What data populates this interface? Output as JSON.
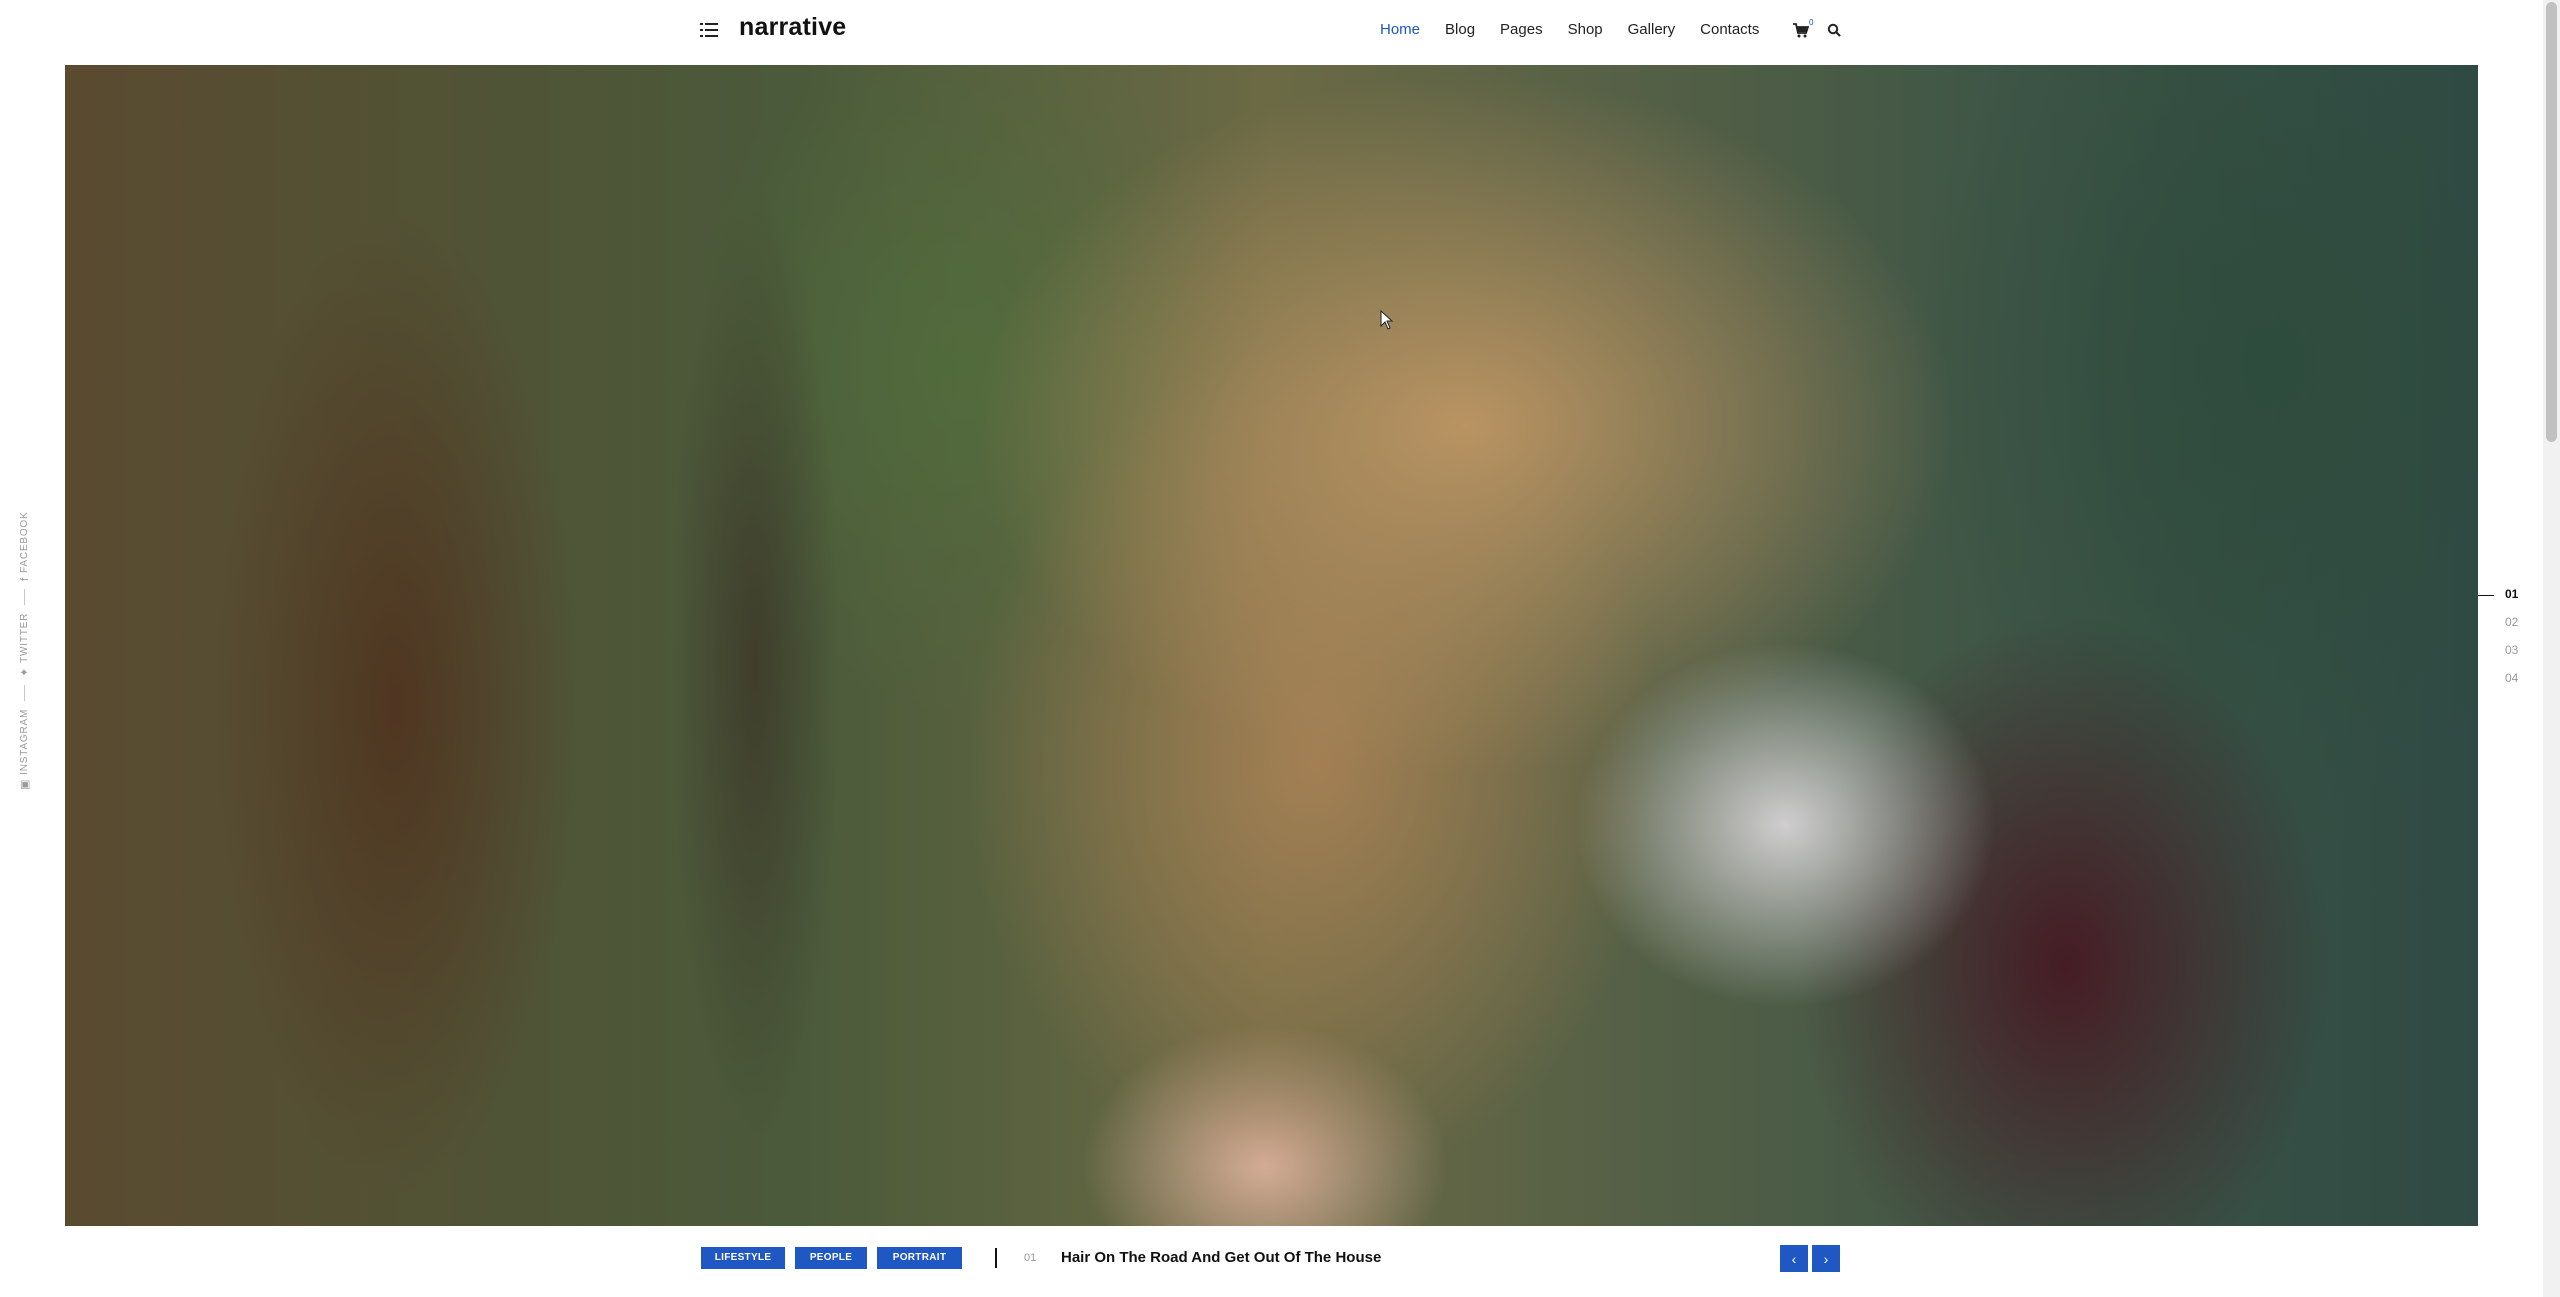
{
  "header": {
    "logo": "narrative",
    "nav": [
      {
        "label": "Home",
        "active": true
      },
      {
        "label": "Blog",
        "active": false
      },
      {
        "label": "Pages",
        "active": false
      },
      {
        "label": "Shop",
        "active": false
      },
      {
        "label": "Gallery",
        "active": false
      },
      {
        "label": "Contacts",
        "active": false
      }
    ],
    "cart_count": "0"
  },
  "social": [
    {
      "label": "INSTAGRAM",
      "icon": "instagram-icon"
    },
    {
      "label": "TWITTER",
      "icon": "twitter-icon"
    },
    {
      "label": "FACEBOOK",
      "icon": "facebook-icon"
    }
  ],
  "slider": {
    "numbers": [
      "01",
      "02",
      "03",
      "04"
    ],
    "active_index": 0
  },
  "current_slide": {
    "tags": [
      "LIFESTYLE",
      "PEOPLE",
      "PORTRAIT"
    ],
    "index": "01",
    "title": "Hair On The Road And Get Out Of The House"
  },
  "colors": {
    "accent": "#1f57c3"
  }
}
